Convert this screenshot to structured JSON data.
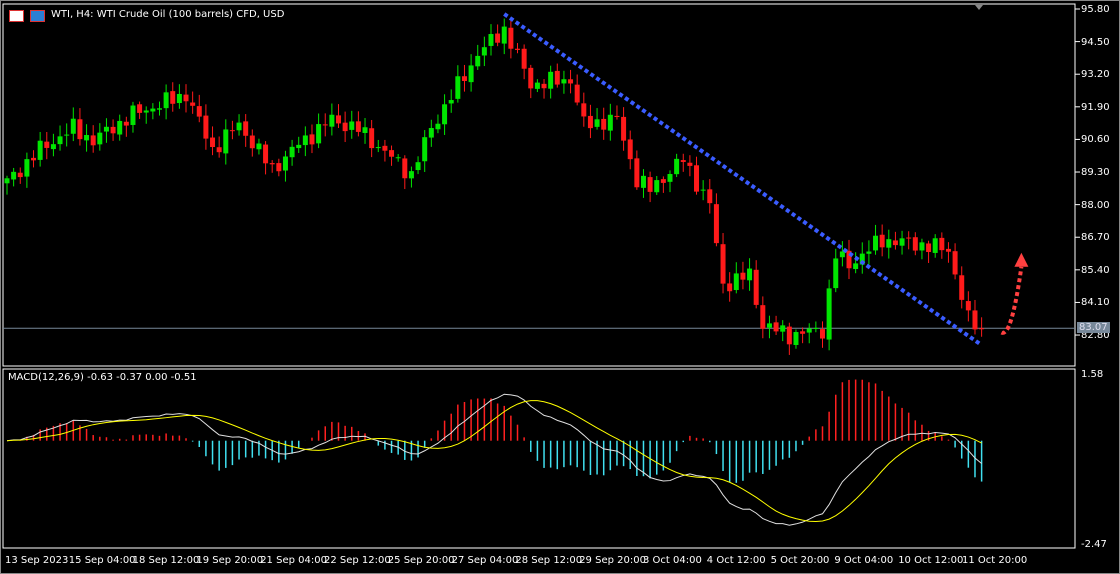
{
  "header": {
    "title": "WTI, H4:  WTI Crude Oil (100 barrels) CFD, USD",
    "icons": [
      "trade-panel-icon",
      "chart-icon"
    ]
  },
  "indicator": {
    "label": "MACD(12,26,9) -0.63 -0.37 0.00 -0.51"
  },
  "price_axis": [
    "95.80",
    "94.50",
    "93.20",
    "91.90",
    "90.60",
    "89.30",
    "88.00",
    "86.70",
    "85.40",
    "84.10",
    "82.80"
  ],
  "current_price": "83.07",
  "macd_axis": [
    "1.58",
    "-2.47"
  ],
  "time_axis": [
    "13 Sep 2023",
    "15 Sep 04:00",
    "18 Sep 12:00",
    "19 Sep 20:00",
    "21 Sep 04:00",
    "22 Sep 12:00",
    "25 Sep 20:00",
    "27 Sep 04:00",
    "28 Sep 12:00",
    "29 Sep 20:00",
    "3 Oct 04:00",
    "4 Oct 12:00",
    "5 Oct 20:00",
    "9 Oct 04:00",
    "10 Oct 12:00",
    "11 Oct 20:00"
  ],
  "colors": {
    "bull": "#00e600",
    "bear": "#ff1a1a",
    "trendline": "#3a5cff",
    "arrow": "#ff4040",
    "macd_main": "#e0e0e0",
    "macd_signal": "#ffff00",
    "hist_pos": "#ff2020",
    "hist_neg": "#40e0f0"
  },
  "chart_data": {
    "type": "candlestick",
    "symbol": "WTI",
    "timeframe": "H4",
    "ylim": [
      82.8,
      95.8
    ],
    "candle_count": 148,
    "close_path": [
      [
        0,
        88.9
      ],
      [
        5,
        90.2
      ],
      [
        10,
        91.05
      ],
      [
        13,
        90.55
      ],
      [
        19,
        91.6
      ],
      [
        27,
        92.4
      ],
      [
        31,
        90.2
      ],
      [
        35,
        91.2
      ],
      [
        40,
        89.4
      ],
      [
        44,
        90.4
      ],
      [
        49,
        91.4
      ],
      [
        53,
        91.0
      ],
      [
        61,
        89.2
      ],
      [
        64,
        91.05
      ],
      [
        71,
        94.0
      ],
      [
        75,
        95.0
      ],
      [
        79,
        92.8
      ],
      [
        85,
        93.0
      ],
      [
        87,
        91.2
      ],
      [
        92,
        91.4
      ],
      [
        95,
        89.0
      ],
      [
        97,
        88.6
      ],
      [
        102,
        89.8
      ],
      [
        106,
        88.0
      ],
      [
        108,
        84.8
      ],
      [
        112,
        85.2
      ],
      [
        114,
        83.2
      ],
      [
        118,
        82.8
      ],
      [
        123,
        83.0
      ],
      [
        125,
        86.0
      ],
      [
        127,
        85.6
      ],
      [
        132,
        86.6
      ],
      [
        138,
        86.4
      ],
      [
        142,
        86.2
      ],
      [
        145,
        83.4
      ],
      [
        147,
        83.07
      ]
    ],
    "trendline": {
      "from": [
        75,
        95.6
      ],
      "to": [
        147,
        82.4
      ],
      "style": "dotted"
    },
    "arrow": {
      "direction": "up",
      "from": [
        150,
        82.9
      ],
      "to": [
        153,
        86.0
      ]
    },
    "macd": {
      "fast": 12,
      "slow": 26,
      "signal": 9,
      "main": -0.63,
      "signal_value": -0.37,
      "ylim": [
        -2.47,
        1.58
      ]
    }
  }
}
